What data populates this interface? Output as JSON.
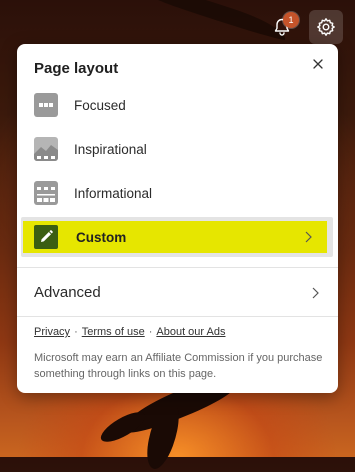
{
  "header": {
    "notifications": {
      "icon": "bell-icon",
      "badge_count": "1"
    },
    "settings": {
      "icon": "gear-icon"
    }
  },
  "panel": {
    "title": "Page layout",
    "close_icon": "close-icon",
    "layouts": [
      {
        "label": "Focused",
        "icon": "focused-layout-icon",
        "selected": false
      },
      {
        "label": "Inspirational",
        "icon": "inspirational-layout-icon",
        "selected": false
      },
      {
        "label": "Informational",
        "icon": "informational-layout-icon",
        "selected": false
      },
      {
        "label": "Custom",
        "icon": "pencil-icon",
        "selected": true
      }
    ],
    "advanced_label": "Advanced",
    "links": {
      "privacy": "Privacy",
      "terms": "Terms of use",
      "ads": "About our Ads",
      "separator": "·"
    },
    "disclaimer": "Microsoft may earn an Affiliate Commission if you purchase something through links on this page."
  },
  "colors": {
    "highlight": "#e6e600",
    "custom_icon_bg": "#3b5e12",
    "badge": "#c4532a",
    "layout_icon": "#9a9a9a"
  }
}
